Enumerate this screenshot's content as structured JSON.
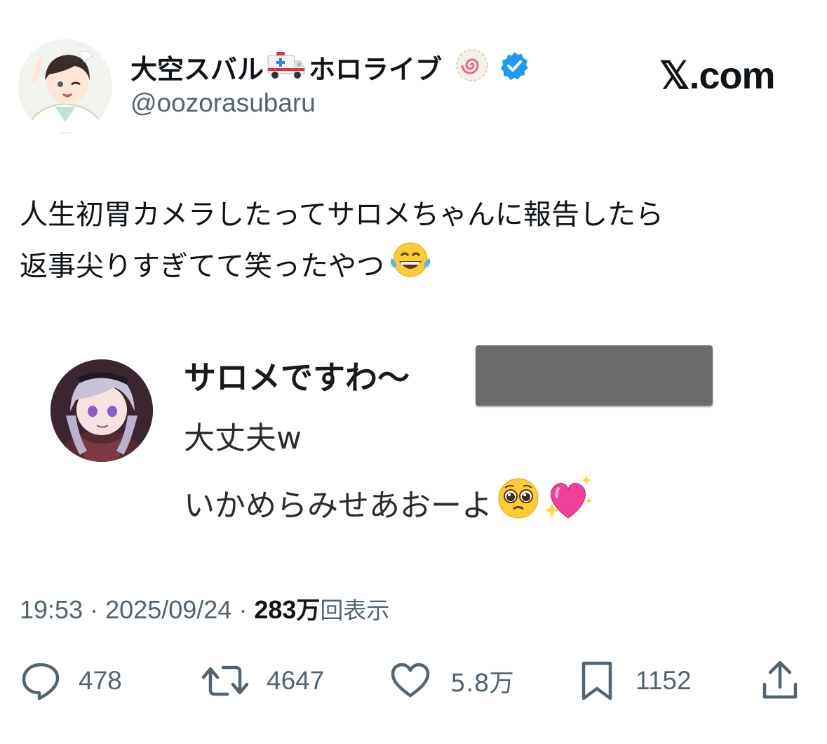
{
  "user": {
    "display_name": "大空スバル",
    "display_name_suffix": "ホロライブ",
    "handle": "@oozorasubaru",
    "verified": true,
    "accent_color": "#1d9bf0"
  },
  "brand": "𝕏.com",
  "tweet": {
    "line1": "人生初胃カメラしたってサロメちゃんに報告したら",
    "line2": "返事尖りすぎてて笑ったやつ"
  },
  "embedded_chat": {
    "sender_name": "サロメですわ〜",
    "message1": "大丈夫w",
    "message2": "いかめらみせあおーよ"
  },
  "meta": {
    "time": "19:53",
    "date": "2025/09/24",
    "separator": "·",
    "views_number": "283",
    "views_unit": "万",
    "views_label": "回表示"
  },
  "actions": {
    "replies": "478",
    "reposts": "4647",
    "likes": "5.8万",
    "bookmarks": "1152"
  },
  "icons": {
    "emoji_ambulance": "ambulance-icon",
    "emoji_naruto": "naruto-icon",
    "verified": "verified-badge-icon",
    "emoji_laugh": "tears-of-joy-icon",
    "emoji_pleading": "pleading-face-icon",
    "emoji_heart": "sparkling-heart-icon",
    "reply": "reply-icon",
    "repost": "repost-icon",
    "like": "heart-icon",
    "bookmark": "bookmark-icon",
    "share": "share-icon"
  }
}
